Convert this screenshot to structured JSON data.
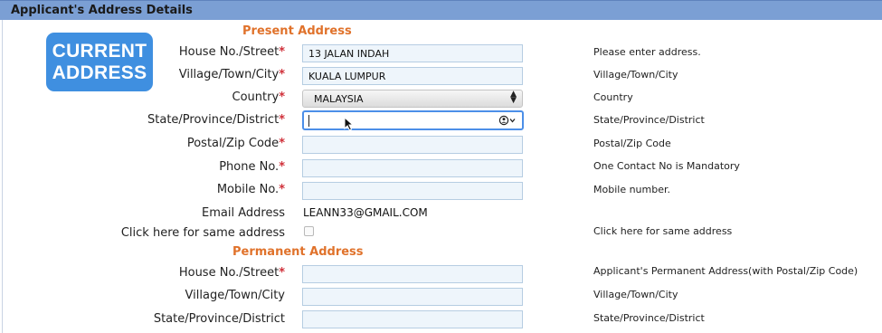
{
  "header": {
    "title": "Applicant's Address Details"
  },
  "badge": {
    "line1": "CURRENT",
    "line2": "ADDRESS"
  },
  "present": {
    "title": "Present Address",
    "rows": [
      {
        "label": "House No./Street",
        "value": "13 JALAN INDAH",
        "hint": "Please enter address."
      },
      {
        "label": "Village/Town/City",
        "value": "KUALA LUMPUR",
        "hint": "Village/Town/City"
      },
      {
        "label": "Country",
        "value": "MALAYSIA",
        "hint": "Country"
      },
      {
        "label": "State/Province/District",
        "value": "",
        "hint": "State/Province/District"
      },
      {
        "label": "Postal/Zip Code",
        "value": "",
        "hint": "Postal/Zip Code"
      },
      {
        "label": "Phone No.",
        "value": "",
        "hint": "One Contact No is Mandatory"
      },
      {
        "label": "Mobile No.",
        "value": "",
        "hint": "Mobile number."
      }
    ],
    "email": {
      "label": "Email Address",
      "value": "LEANN33@GMAIL.COM"
    },
    "same": {
      "label": "Click here for same address",
      "hint": "Click here for same address"
    }
  },
  "permanent": {
    "title": "Permanent Address",
    "rows": [
      {
        "label": "House No./Street",
        "value": "",
        "hint": "Applicant's Permanent Address(with Postal/Zip Code)"
      },
      {
        "label": "Village/Town/City",
        "value": "",
        "hint": "Village/Town/City"
      },
      {
        "label": "State/Province/District",
        "value": "",
        "hint": "State/Province/District"
      }
    ]
  },
  "required_marker": "*",
  "colors": {
    "header": "#7b9fd4",
    "section_title": "#e0722b",
    "required": "#d0303a",
    "badge": "#3f8fe0",
    "focus": "#4c8fe8"
  },
  "icons": {
    "select": "up-down-arrows-icon",
    "autofill": "contact-autofill-icon",
    "pointer": "mouse-cursor-icon"
  }
}
